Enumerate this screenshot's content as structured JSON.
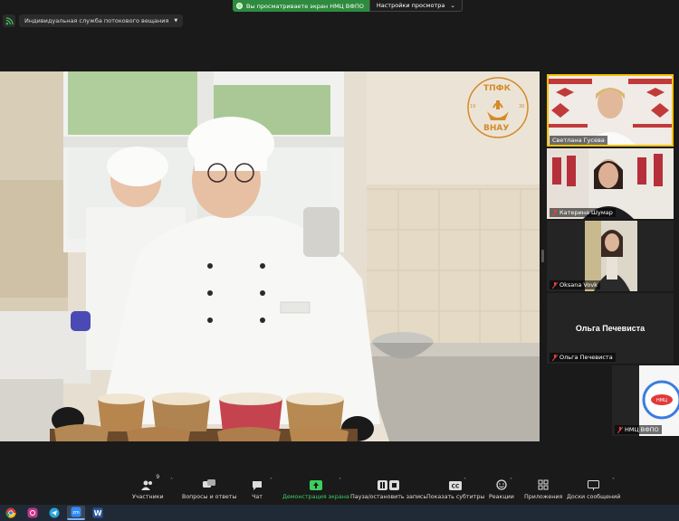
{
  "share_banner": {
    "status_text": "Вы просматриваете экран НМЦ ВФПО",
    "options_label": "Настройки просмотра"
  },
  "stream": {
    "label": "Индивидуальная служба потокового вещания"
  },
  "main_video": {
    "logo_top": "ТПФК",
    "logo_bottom": "ВНАУ",
    "logo_year_left": "19",
    "logo_year_right": "30"
  },
  "participants": [
    {
      "name": "Светлана Гусева",
      "muted": false,
      "active": true
    },
    {
      "name": "Катерина Шумар",
      "muted": true,
      "active": false
    },
    {
      "name": "Oksana Vovk",
      "muted": true,
      "active": false
    },
    {
      "name": "Ольга Печевиста",
      "card_text": "Ольга Печевиста",
      "muted": true,
      "active": false
    },
    {
      "name": "НМЦ ВФПО",
      "muted": true,
      "active": false
    }
  ],
  "toolbar": {
    "participants_count": "9",
    "participants": "Участники",
    "qa": "Вопросы и ответы",
    "chat": "Чат",
    "share": "Демонстрация экрана",
    "pause_record": "Пауза/остановить запись",
    "subtitles": "Показать субтитры",
    "reactions": "Реакции",
    "apps": "Приложения",
    "whiteboards": "Доски сообщений"
  },
  "colors": {
    "share_green": "#2e8b3e",
    "active_speaker": "#f3c200",
    "bg": "#1a1a1a"
  }
}
